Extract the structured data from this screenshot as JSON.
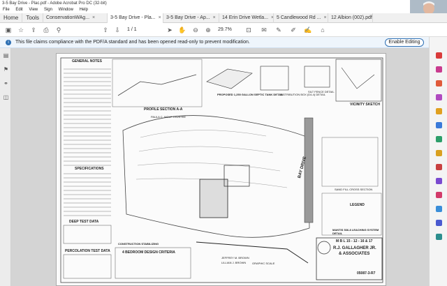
{
  "window": {
    "title": "3-5 Bay Drive - Plac.pdf - Adobe Acrobat Pro DC (32-bit)"
  },
  "menu": [
    "File",
    "Edit",
    "View",
    "Sign",
    "Window",
    "Help"
  ],
  "tabs": [
    {
      "label": "Home"
    },
    {
      "label": "Tools"
    },
    {
      "label": "ConservationWAg..."
    },
    {
      "label": "3-5 Bay Drive - Pla..."
    },
    {
      "label": "3-5 Bay Drive - Ap..."
    },
    {
      "label": "14 Erin Drive Wetla..."
    },
    {
      "label": "5 Candlewood Rd ..."
    },
    {
      "label": "12 Albion (002).pdf"
    }
  ],
  "toolbar": {
    "page_current": "1",
    "page_total": "/ 1",
    "zoom": "29.7%"
  },
  "notice": {
    "text": "This file claims compliance with the PDF/A standard and has been opened read-only to prevent modification.",
    "button": "Enable Editing"
  },
  "drawing": {
    "general_notes": "GENERAL NOTES",
    "specifications": "SPECIFICATIONS",
    "deep_test": "DEEP TEST DATA",
    "perc_test": "PERCOLATION TEST DATA",
    "profile": "PROFILE SECTION A-A",
    "septic": "PROPOSED 1,250 GALLON SEPTIC TANK DETAIL",
    "distribution": "DISTRIBUTION BOX (D4-4) DETAIL",
    "silt": "SILT FENCE DETAIL",
    "vicinity": "VICINITY SKETCH",
    "legend": "LEGEND",
    "sand_fill": "SAND FILL CROSS SECTION",
    "leaching": "MANTIS 536-8 LEACHING SYSTEM DETAIL",
    "construction": "CONSTRUCTION STABILIZING",
    "design": "4 BEDROOM DESIGN CRITERIA",
    "bay_drive": "BAY DRIVE",
    "owner_a": "PAULA C. WOLF TRUSTEE",
    "owner_b": "JEFFREY M. BROWN",
    "owner_c": "LILLIAN J. BROWN",
    "mbl": "M B L  15 - 12 - 16 & 17",
    "firm_a": "R.J. GALLAGHER JR.",
    "firm_b": "& ASSOCIATES",
    "drawing_no": "05087-3-R7",
    "graphic_scale": "GRAPHIC SCALE"
  },
  "colors": {
    "accent": "#2d6fb3",
    "notice_bg": "#eef5fc"
  }
}
